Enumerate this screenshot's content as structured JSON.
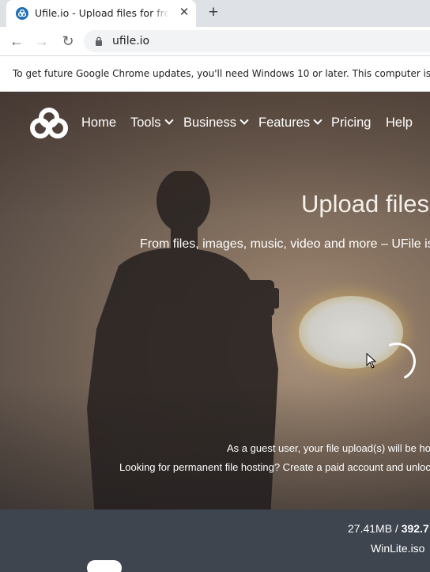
{
  "browser": {
    "tab": {
      "title": "Ufile.io - Upload files for free & s",
      "close_glyph": "✕"
    },
    "new_tab_glyph": "+",
    "back_glyph": "←",
    "forward_glyph": "→",
    "reload_glyph": "↻",
    "url": "ufile.io",
    "infobar_text": "To get future Google Chrome updates, you'll need Windows 10 or later. This computer is using"
  },
  "site": {
    "nav": {
      "home": "Home",
      "tools": "Tools",
      "business": "Business",
      "features": "Features",
      "pricing": "Pricing",
      "help": "Help"
    },
    "hero_title": "Upload files f",
    "hero_subtitle": "From files, images, music, video and more – UFile is",
    "guest_note": "As a guest user, your file upload(s) will be hos",
    "permanent_note": "Looking for permanent file hosting? Create a paid account and unlock",
    "upload": {
      "uploaded": "27.41MB",
      "separator": " / ",
      "total": "392.7",
      "file_name": "WinLite.iso"
    }
  },
  "colors": {
    "accent": "#2b6cb0",
    "panel": "#3e454f",
    "tab_strip": "#dee1e6"
  }
}
